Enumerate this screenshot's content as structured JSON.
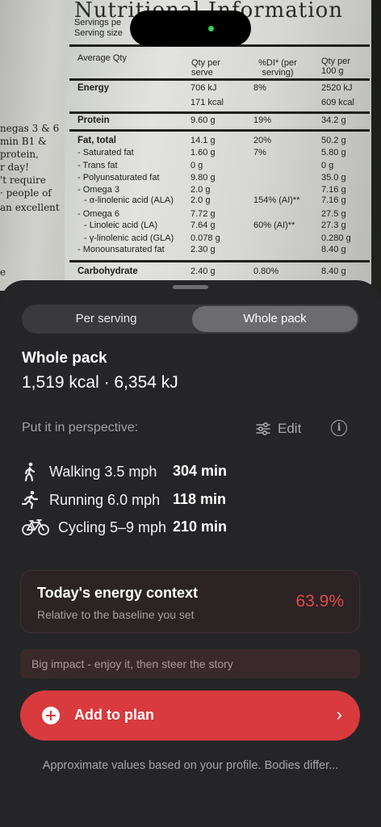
{
  "background_label": {
    "title": "Nutritional Information",
    "servings_line1": "Servings pe",
    "servings_line2": "Serving size",
    "header_avg": "Average Qty",
    "header_serve": "Qty per serve",
    "header_di": "%DI* (per serving)",
    "header_100": "Qty per 100 g",
    "rows": [
      {
        "name": "Energy",
        "serve": "706 kJ",
        "di": "8%",
        "per100": "2520 kJ"
      },
      {
        "name": "",
        "serve": "171 kcal",
        "di": "",
        "per100": "609 kcal"
      },
      {
        "name": "Protein",
        "serve": "9.60 g",
        "di": "19%",
        "per100": "34.2 g"
      },
      {
        "name": "Fat, total",
        "serve": "14.1 g",
        "di": "20%",
        "per100": "50.2 g"
      },
      {
        "name": "- Saturated fat",
        "serve": "1.60 g",
        "di": "7%",
        "per100": "5.80 g"
      },
      {
        "name": "- Trans fat",
        "serve": "0 g",
        "di": "",
        "per100": "0 g"
      },
      {
        "name": "- Polyunsaturated fat",
        "serve": "9.80 g",
        "di": "",
        "per100": "35.0 g"
      },
      {
        "name": "- Omega 3",
        "serve": "2.0 g",
        "di": "",
        "per100": "7.16 g"
      },
      {
        "name": "- α-linolenic acid (ALA)",
        "serve": "2.0 g",
        "di": "154% (AI)**",
        "per100": "7.16 g"
      },
      {
        "name": "- Omega 6",
        "serve": "7.72 g",
        "di": "",
        "per100": "27.5 g"
      },
      {
        "name": "- Linoleic acid (LA)",
        "serve": "7.64 g",
        "di": "60% (AI)**",
        "per100": "27.3 g"
      },
      {
        "name": "- γ-linolenic acid (GLA)",
        "serve": "0.078 g",
        "di": "",
        "per100": "0.280 g"
      },
      {
        "name": "- Monounsaturated fat",
        "serve": "2.30 g",
        "di": "",
        "per100": "8.40 g"
      },
      {
        "name": "Carbohydrate",
        "serve": "2.40 g",
        "di": "0.80%",
        "per100": "8.40 g"
      }
    ],
    "left_lines": [
      "negas 3 & 6",
      "min B1 &",
      "protein,",
      "r day!",
      "'t require",
      "· people of",
      "an excellent",
      "",
      "",
      "e"
    ]
  },
  "segmented": {
    "option_1": "Per serving",
    "option_2": "Whole pack",
    "selected": "Whole pack"
  },
  "summary": {
    "heading": "Whole pack",
    "energy": "1,519 kcal · 6,354 kJ"
  },
  "perspective": {
    "label": "Put it in perspective:",
    "edit_label": "Edit",
    "info_icon": "info-icon",
    "edit_icon": "sliders-icon"
  },
  "activities": [
    {
      "icon": "walking-icon",
      "label": "Walking 3.5 mph",
      "value": "304 min"
    },
    {
      "icon": "running-icon",
      "label": "Running 6.0 mph",
      "value": "118 min"
    },
    {
      "icon": "bicycle-icon",
      "label": "Cycling 5–9 mph",
      "value": "210 min"
    }
  ],
  "context": {
    "title": "Today's energy context",
    "subtitle": "Relative to the baseline you set",
    "percent": "63.9%",
    "percent_color": "#e0494d"
  },
  "impact_message": "Big impact - enjoy it, then steer the story",
  "cta": {
    "label": "Add to plan",
    "color": "#d83a3e"
  },
  "footer_note": "Approximate values based on your profile. Bodies differ..."
}
